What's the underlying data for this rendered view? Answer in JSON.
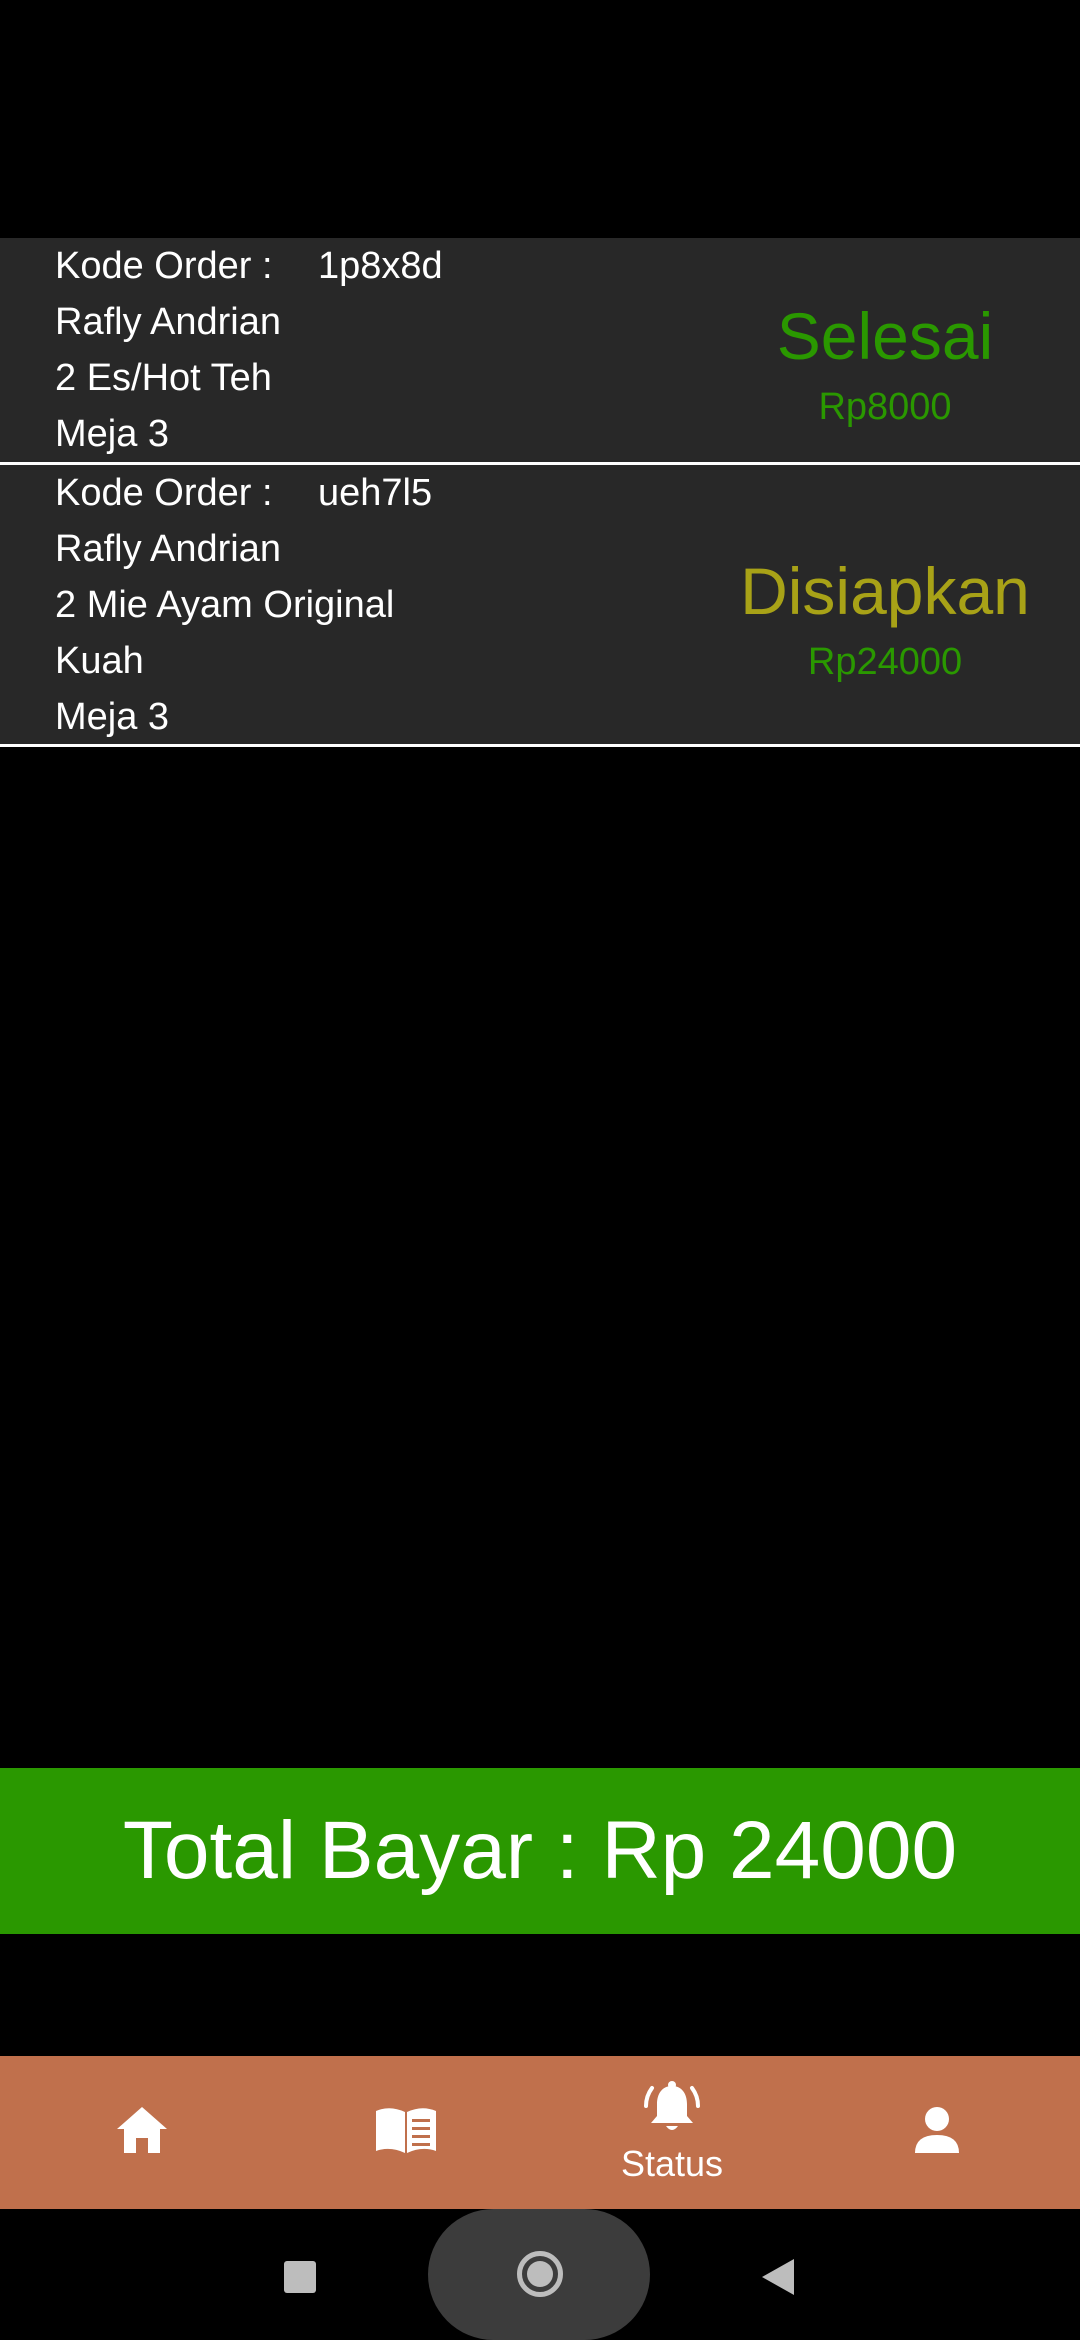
{
  "orders": [
    {
      "code_label": "Kode Order :",
      "code": "1p8x8d",
      "customer": "Rafly Andrian",
      "item": "2 Es/Hot Teh",
      "table": "Meja 3",
      "status": "Selesai",
      "status_color": "#2a9800",
      "price": "Rp8000"
    },
    {
      "code_label": "Kode Order :",
      "code": "ueh7l5",
      "customer": "Rafly Andrian",
      "item": "2 Mie Ayam Original",
      "item_detail": "Kuah",
      "table": "Meja 3",
      "status": "Disiapkan",
      "status_color": "#a8a217",
      "price": "Rp24000"
    }
  ],
  "total": {
    "label": "Total Bayar : Rp 24000"
  },
  "bottom_nav": {
    "items": [
      {
        "icon": "home-icon",
        "label": ""
      },
      {
        "icon": "book-icon",
        "label": ""
      },
      {
        "icon": "bell-icon",
        "label": "Status",
        "active": true
      },
      {
        "icon": "person-icon",
        "label": ""
      }
    ]
  },
  "colors": {
    "background": "#000000",
    "card": "#282828",
    "total_bar": "#2a9800",
    "bottom_nav": "#c0704c",
    "price": "#2a9800"
  }
}
